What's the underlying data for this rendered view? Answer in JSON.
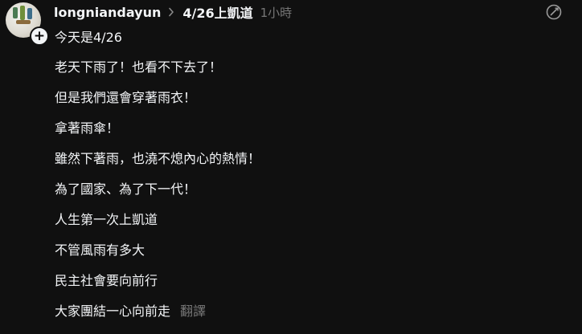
{
  "post": {
    "username": "longniandayun",
    "topic": "4/26上凱道",
    "time": "1小時",
    "lines": [
      "今天是4/26",
      "老天下雨了！也看不下去了！",
      "但是我們還會穿著雨衣！",
      "拿著雨傘！",
      "雖然下著雨，也澆不熄內心的熱情！",
      "為了國家、為了下一代！",
      "人生第一次上凱道",
      "不管風雨有多大",
      "民主社會要向前行",
      "大家團結一心向前走"
    ],
    "translate_label": "翻譯",
    "follow_symbol": "+"
  },
  "icons": {
    "follow": "plus-icon",
    "separator": "chevron-right-icon",
    "more": "more-options-icon"
  },
  "colors": {
    "background": "#101010",
    "text": "#f3f5f7",
    "muted": "#777777"
  }
}
